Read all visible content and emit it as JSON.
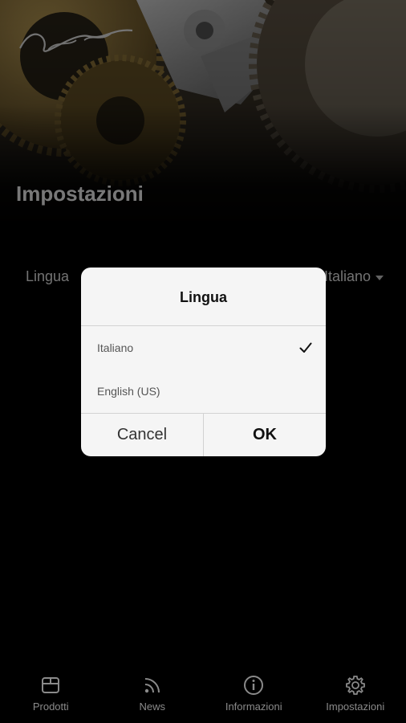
{
  "page": {
    "title": "Impostazioni"
  },
  "settings": {
    "language_label": "Lingua",
    "language_value": "Italiano"
  },
  "dialog": {
    "title": "Lingua",
    "options": [
      {
        "label": "Italiano",
        "selected": true
      },
      {
        "label": "English (US)",
        "selected": false
      }
    ],
    "cancel_label": "Cancel",
    "ok_label": "OK"
  },
  "nav": {
    "items": [
      {
        "label": "Prodotti",
        "icon": "box-icon"
      },
      {
        "label": "News",
        "icon": "rss-icon"
      },
      {
        "label": "Informazioni",
        "icon": "info-icon"
      },
      {
        "label": "Impostazioni",
        "icon": "gear-icon"
      }
    ]
  },
  "colors": {
    "background": "#000000",
    "dialog_bg": "#f5f5f5",
    "nav_inactive": "#8a8a8a"
  }
}
